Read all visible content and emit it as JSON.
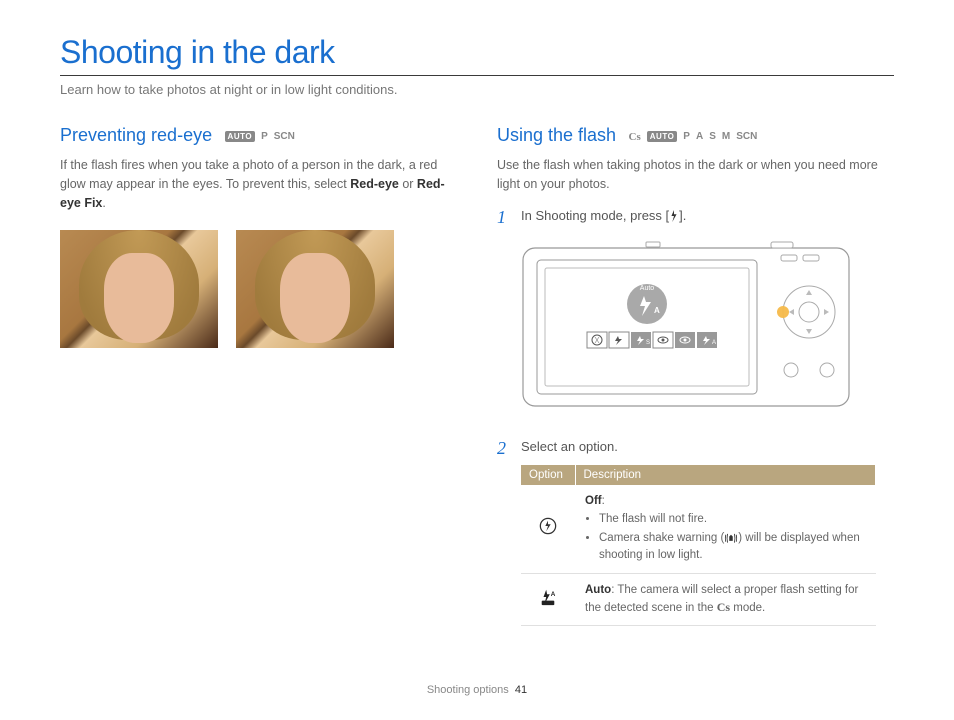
{
  "pageTitle": "Shooting in the dark",
  "subtitle": "Learn how to take photos at night or in low light conditions.",
  "left": {
    "heading": "Preventing red-eye",
    "modes": {
      "auto": "AUTO",
      "p": "P",
      "scn": "SCN"
    },
    "body_pre": "If the flash fires when you take a photo of a person in the dark, a red glow may appear in the eyes. To prevent this, select ",
    "body_bold1": "Red-eye",
    "body_mid": " or ",
    "body_bold2": "Red-eye Fix",
    "body_post": "."
  },
  "right": {
    "heading": "Using the flash",
    "modes": {
      "cs": "Cs",
      "auto": "AUTO",
      "p": "P",
      "a": "A",
      "s": "S",
      "m": "M",
      "scn": "SCN"
    },
    "body": "Use the flash when taking photos in the dark or when you need more light on your photos.",
    "step1_num": "1",
    "step1_pre": "In Shooting mode, press [",
    "step1_post": "].",
    "diagram_label": "Auto",
    "step2_num": "2",
    "step2_text": "Select an option.",
    "table": {
      "head_option": "Option",
      "head_desc": "Description",
      "row1": {
        "title": "Off",
        "bullet1": "The flash will not fire.",
        "bullet2_pre": "Camera shake warning (",
        "bullet2_post": ") will be displayed when shooting in low light."
      },
      "row2": {
        "title": "Auto",
        "text_pre": ": The camera will select a proper flash setting for the detected scene in the ",
        "text_post": " mode."
      }
    }
  },
  "footer": {
    "section": "Shooting options",
    "page": "41"
  }
}
